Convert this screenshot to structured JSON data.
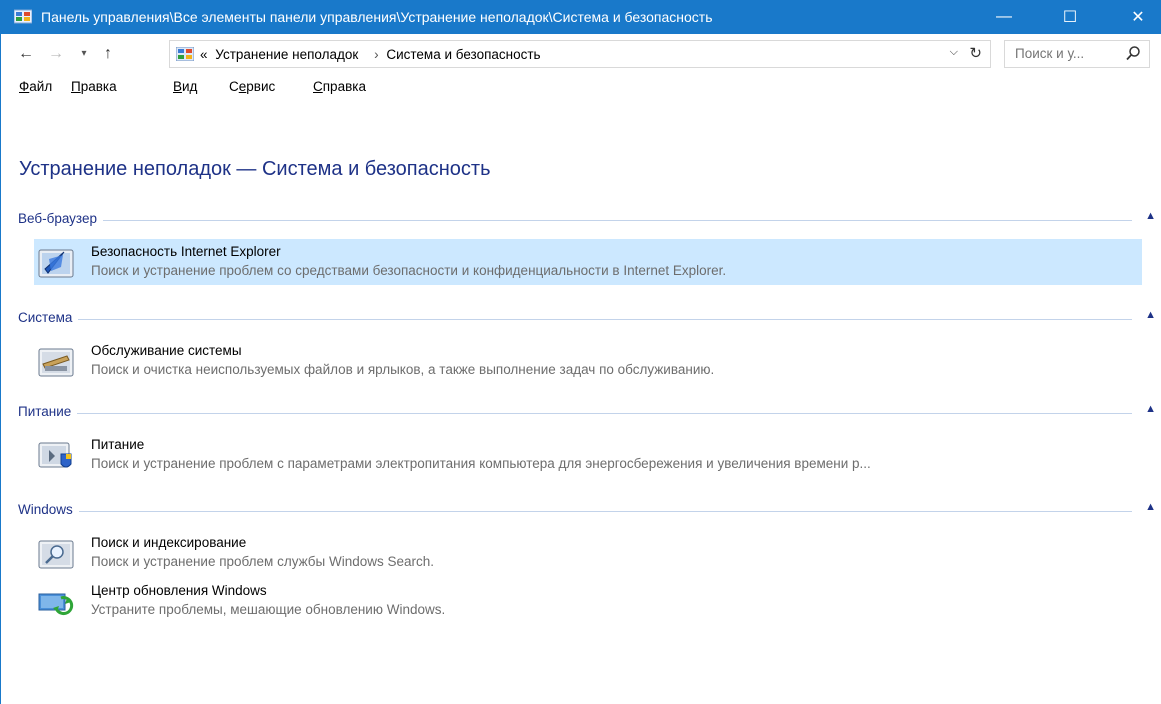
{
  "window": {
    "title": "Панель управления\\Все элементы панели управления\\Устранение неполадок\\Система и безопасность",
    "controls": {
      "minimize": "—",
      "maximize": "☐",
      "close": "✕"
    }
  },
  "address": {
    "overflow": "«",
    "crumbs": [
      "Устранение неполадок",
      "Система и безопасность"
    ],
    "search_placeholder": "Поиск и у..."
  },
  "menu": {
    "items": [
      {
        "accel": "Ф",
        "rest": "айл"
      },
      {
        "accel": "П",
        "rest": "равка"
      },
      {
        "accel": "В",
        "rest": "ид"
      },
      {
        "pre": "С",
        "accel": "е",
        "rest": "рвис"
      },
      {
        "accel": "С",
        "rest": "правка"
      }
    ]
  },
  "page": {
    "title": "Устранение неполадок — Система и безопасность"
  },
  "groups": [
    {
      "name": "Веб-браузер",
      "items": [
        {
          "title": "Безопасность Internet Explorer",
          "desc": "Поиск и устранение проблем со средствами безопасности и конфиденциальности в Internet Explorer.",
          "icon": "ie-security-icon",
          "selected": true
        }
      ]
    },
    {
      "name": "Система",
      "items": [
        {
          "title": "Обслуживание системы",
          "desc": "Поиск и очистка неиспользуемых файлов и ярлыков, а также выполнение задач по обслуживанию.",
          "icon": "system-maintenance-icon"
        }
      ]
    },
    {
      "name": "Питание",
      "items": [
        {
          "title": "Питание",
          "desc": "Поиск и устранение проблем с параметрами электропитания компьютера для энергосбережения и увеличения  времени р...",
          "icon": "power-icon"
        }
      ]
    },
    {
      "name": "Windows",
      "items": [
        {
          "title": "Поиск и индексирование",
          "desc": "Поиск и устранение проблем службы Windows Search.",
          "icon": "search-indexing-icon"
        },
        {
          "title": "Центр обновления Windows",
          "desc": "Устраните проблемы, мешающие обновлению Windows.",
          "icon": "windows-update-icon"
        }
      ]
    }
  ],
  "colors": {
    "titlebar": "#1979ca",
    "link": "#1e3287",
    "selection": "#cce8ff",
    "desc": "#6d6d6d"
  }
}
